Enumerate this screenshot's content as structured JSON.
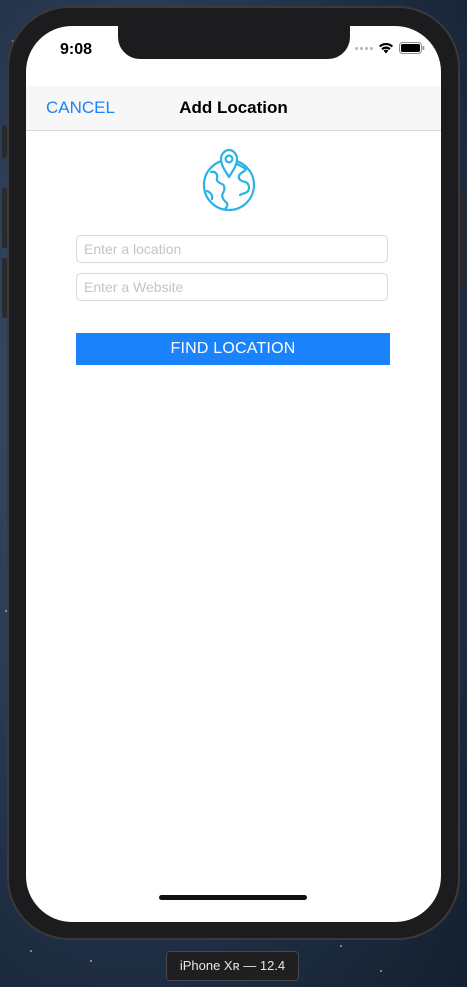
{
  "status_bar": {
    "time": "9:08"
  },
  "navbar": {
    "cancel_label": "CANCEL",
    "title": "Add Location"
  },
  "form": {
    "location_placeholder": "Enter a location",
    "location_value": "",
    "website_placeholder": "Enter a Website",
    "website_value": "",
    "find_button_label": "FIND LOCATION"
  },
  "simulator": {
    "device_label": "iPhone Xʀ — 12.4"
  },
  "icons": {
    "header_icon": "globe-pin-icon",
    "wifi": "wifi-icon",
    "battery": "battery-icon",
    "signal": "signal-dots-icon"
  },
  "colors": {
    "accent": "#1a82fb",
    "icon": "#29b3e5",
    "navbar_bg": "#f7f7f7"
  }
}
